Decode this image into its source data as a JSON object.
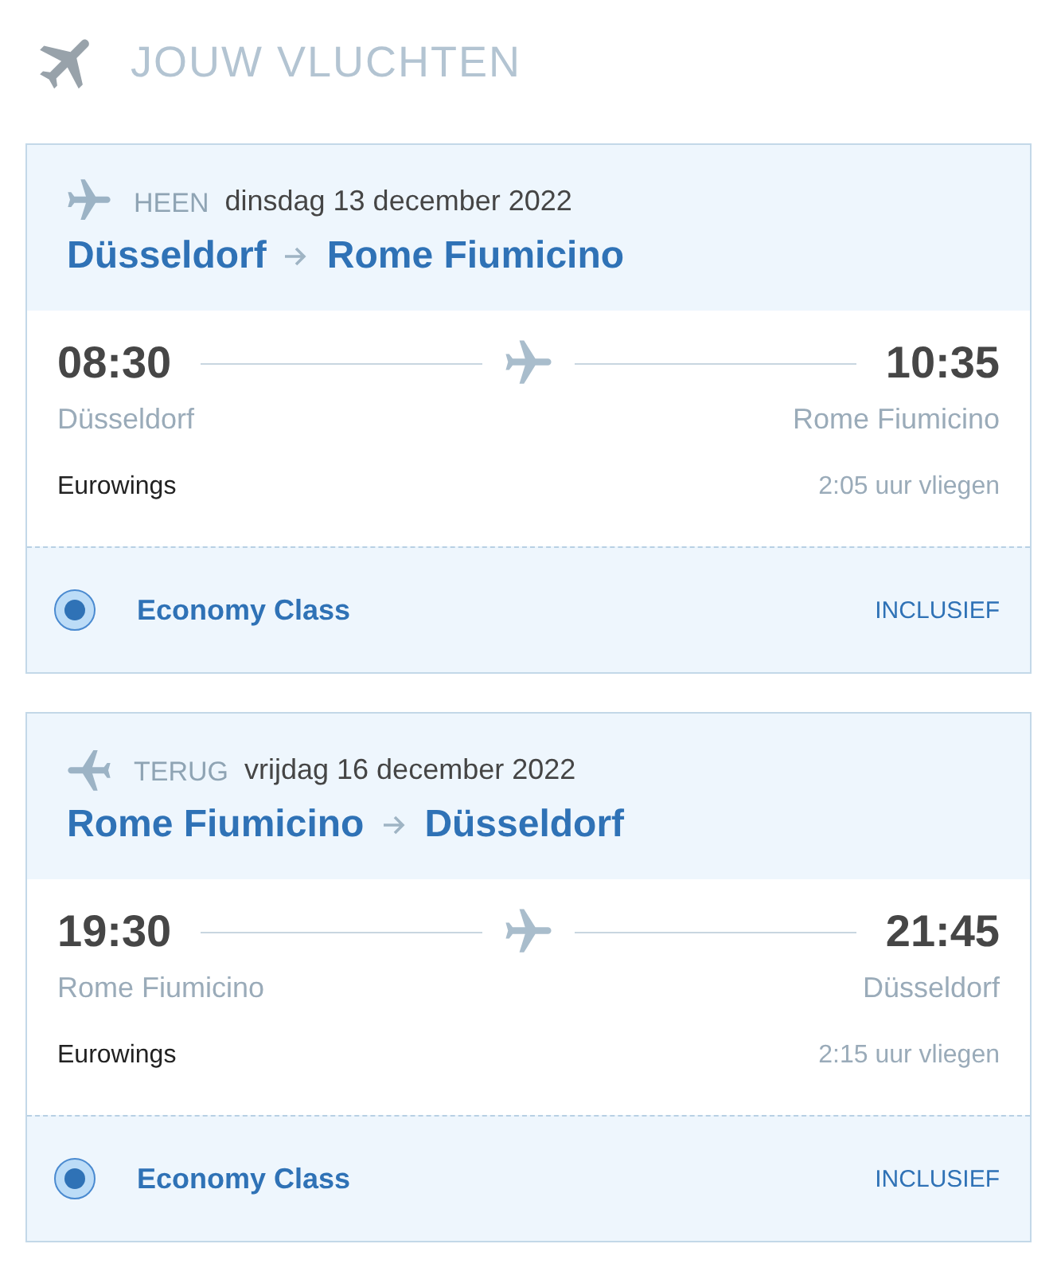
{
  "header": {
    "title": "JOUW VLUCHTEN"
  },
  "flights": [
    {
      "kind": "outbound",
      "label": "HEEN",
      "date": "dinsdag 13 december 2022",
      "route": {
        "from": "Düsseldorf",
        "to": "Rome Fiumicino"
      },
      "departure": {
        "time": "08:30",
        "city": "Düsseldorf"
      },
      "arrival": {
        "time": "10:35",
        "city": "Rome Fiumicino"
      },
      "airline": "Eurowings",
      "duration": "2:05 uur vliegen",
      "fare": {
        "name": "Economy Class",
        "selected": true,
        "price": "INCLUSIEF"
      }
    },
    {
      "kind": "return",
      "label": "TERUG",
      "date": "vrijdag 16 december 2022",
      "route": {
        "from": "Rome Fiumicino",
        "to": "Düsseldorf"
      },
      "departure": {
        "time": "19:30",
        "city": "Rome Fiumicino"
      },
      "arrival": {
        "time": "21:45",
        "city": "Düsseldorf"
      },
      "airline": "Eurowings",
      "duration": "2:15 uur vliegen",
      "fare": {
        "name": "Economy Class",
        "selected": true,
        "price": "INCLUSIEF"
      }
    }
  ]
}
